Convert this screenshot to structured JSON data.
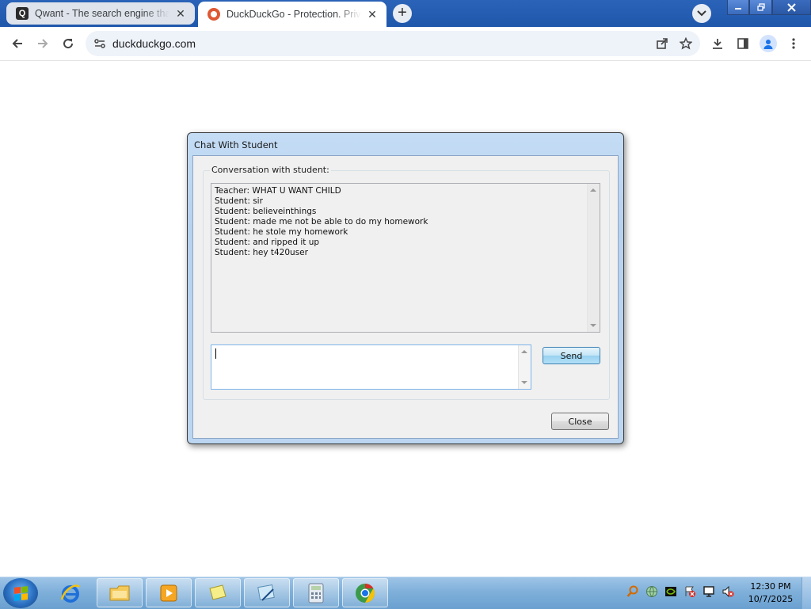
{
  "browser": {
    "tabs": [
      {
        "title": "Qwant - The search engine that",
        "favicon": "qwant-icon",
        "active": false
      },
      {
        "title": "DuckDuckGo - Protection. Privac",
        "favicon": "duckduckgo-icon",
        "active": true
      }
    ],
    "new_tab_label": "+",
    "address": "duckduckgo.com"
  },
  "dialog": {
    "title": "Chat With Student",
    "group_label": "Conversation with student:",
    "messages": [
      "Teacher: WHAT U WANT CHILD",
      "Student: sir",
      "Student: believeinthings",
      "Student: made me not be able to do my homework",
      "Student: he stole my homework",
      "Student: and ripped it up",
      "Student: hey t420user"
    ],
    "input_value": "",
    "send_label": "Send",
    "close_label": "Close"
  },
  "taskbar": {
    "apps": [
      "internet-explorer-icon",
      "windows-explorer-icon",
      "media-player-icon",
      "sticky-notes-icon",
      "snipping-tool-icon",
      "calculator-icon",
      "chrome-icon"
    ],
    "tray": [
      "search-icon",
      "network-globe-icon",
      "nvidia-icon",
      "action-center-icon",
      "display-icon",
      "volume-muted-icon"
    ],
    "time": "12:30 PM",
    "date": "10/7/2025"
  },
  "colors": {
    "tabstrip": "#1f57ab",
    "dialog_frame": "#bcd6f1",
    "dialog_client": "#f0f0f0",
    "taskbar": "#7fb0da"
  }
}
